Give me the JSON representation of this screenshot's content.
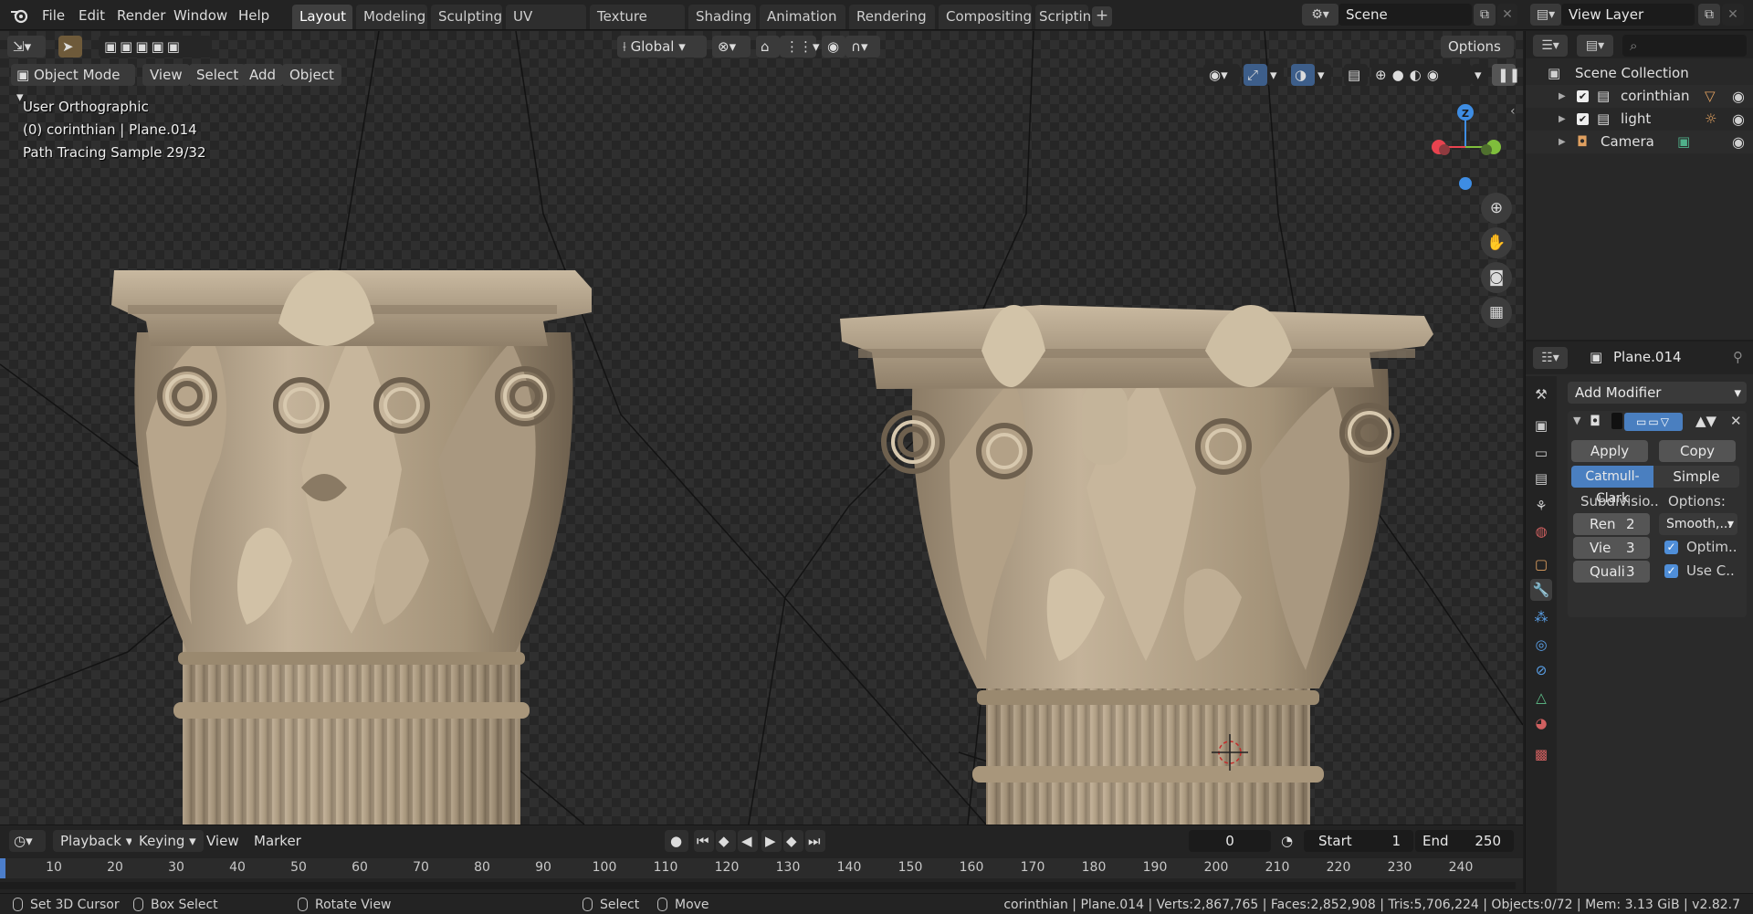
{
  "topbar": {
    "menus": [
      "File",
      "Edit",
      "Render",
      "Window",
      "Help"
    ],
    "workspaces": [
      "Layout",
      "Modeling",
      "Sculpting",
      "UV Editing",
      "Texture Paint",
      "Shading",
      "Animation",
      "Rendering",
      "Compositing",
      "Scripting"
    ],
    "active_workspace": "Layout",
    "scene_label": "Scene",
    "view_layer_label": "View Layer"
  },
  "viewport": {
    "mode": "Object Mode",
    "menus": [
      "View",
      "Select",
      "Add",
      "Object"
    ],
    "transform_orientation": "Global",
    "options_label": "Options",
    "overlay_lines": [
      "User Orthographic",
      "(0) corinthian | Plane.014",
      "Path Tracing Sample 29/32"
    ],
    "gizmo_axis_z": "Z",
    "colors": {
      "x_axis": "#e8434f",
      "y_axis": "#7fbe3c",
      "z_axis": "#3e8de3",
      "stone": "#b8a78e"
    }
  },
  "timeline": {
    "menus": [
      "Playback",
      "Keying",
      "View",
      "Marker"
    ],
    "current_frame": "0",
    "start_label": "Start",
    "start_value": "1",
    "end_label": "End",
    "end_value": "250",
    "ticks": [
      "10",
      "20",
      "30",
      "40",
      "50",
      "60",
      "70",
      "80",
      "90",
      "100",
      "110",
      "120",
      "130",
      "140",
      "150",
      "160",
      "170",
      "180",
      "190",
      "200",
      "210",
      "220",
      "230",
      "240"
    ]
  },
  "statusbar": {
    "set_cursor": "Set 3D Cursor",
    "box_select": "Box Select",
    "rotate_view": "Rotate View",
    "select": "Select",
    "move": "Move",
    "stats": "corinthian | Plane.014 | Verts:2,867,765 | Faces:2,852,908 | Tris:5,706,224 | Objects:0/72 | Mem: 3.13 GiB | v2.82.7"
  },
  "outliner": {
    "root": "Scene Collection",
    "items": [
      {
        "name": "corinthian",
        "icon": "collection-icon"
      },
      {
        "name": "light",
        "icon": "collection-icon"
      },
      {
        "name": "Camera",
        "icon": "camera-icon"
      }
    ]
  },
  "properties": {
    "object_name": "Plane.014",
    "add_modifier": "Add Modifier",
    "apply": "Apply",
    "copy": "Copy",
    "catmull": "Catmull-Clark",
    "simple": "Simple",
    "subdivisions_label": "Subdivisio..",
    "options_label": "Options:",
    "render_label": "Ren",
    "render_value": "2",
    "viewport_label": "Vie",
    "viewport_value": "3",
    "quality_label": "Quali",
    "quality_value": "3",
    "smooth_dropdown": "Smooth,...",
    "optimal_label": "Optim..",
    "use_creases_label": "Use C.."
  }
}
